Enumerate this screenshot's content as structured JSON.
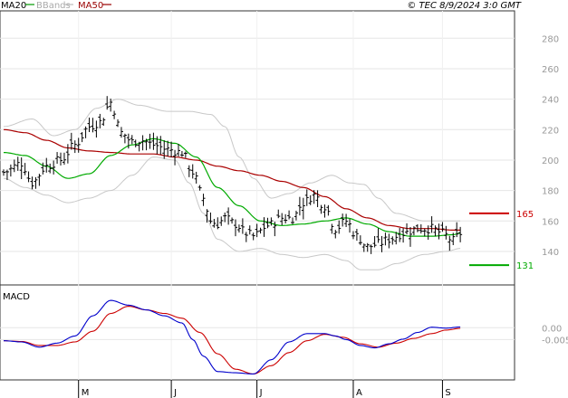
{
  "header": {
    "copyright": "© TEC 8/9/2024 3:0 GMT"
  },
  "chart_data": [
    {
      "type": "line",
      "panel": "price",
      "legend": [
        {
          "name": "MA20",
          "color": "#00aa00"
        },
        {
          "name": "BBands",
          "color": "#bbbbbb"
        },
        {
          "name": "MA50",
          "color": "#aa0000"
        }
      ],
      "legend_placement": "top-left",
      "ylim": [
        118,
        298
      ],
      "yticks": [
        140,
        160,
        180,
        200,
        220,
        240,
        260,
        280
      ],
      "grid": true,
      "x_range": [
        0,
        130
      ],
      "month_ticks": [
        {
          "label": "M",
          "x": 21
        },
        {
          "label": "J",
          "x": 47
        },
        {
          "label": "J",
          "x": 71
        },
        {
          "label": "A",
          "x": 98
        },
        {
          "label": "S",
          "x": 123
        }
      ],
      "levels": [
        {
          "name": "resistance",
          "value": 165,
          "label": "165",
          "color": "#cc0000"
        },
        {
          "name": "support",
          "value": 131,
          "label": "131",
          "color": "#00aa00"
        }
      ],
      "close_anchors": [
        [
          0,
          192
        ],
        [
          5,
          198
        ],
        [
          8,
          185
        ],
        [
          12,
          196
        ],
        [
          16,
          200
        ],
        [
          20,
          210
        ],
        [
          24,
          222
        ],
        [
          27,
          225
        ],
        [
          30,
          238
        ],
        [
          33,
          218
        ],
        [
          36,
          212
        ],
        [
          39,
          213
        ],
        [
          42,
          210
        ],
        [
          46,
          207
        ],
        [
          50,
          205
        ],
        [
          53,
          192
        ],
        [
          56,
          175
        ],
        [
          58,
          160
        ],
        [
          60,
          158
        ],
        [
          62,
          162
        ],
        [
          65,
          158
        ],
        [
          68,
          152
        ],
        [
          70,
          150
        ],
        [
          74,
          157
        ],
        [
          78,
          162
        ],
        [
          81,
          162
        ],
        [
          84,
          172
        ],
        [
          87,
          177
        ],
        [
          90,
          170
        ],
        [
          93,
          155
        ],
        [
          96,
          160
        ],
        [
          99,
          150
        ],
        [
          102,
          143
        ],
        [
          105,
          145
        ],
        [
          108,
          148
        ],
        [
          112,
          152
        ],
        [
          116,
          155
        ],
        [
          120,
          155
        ],
        [
          123,
          152
        ],
        [
          126,
          147
        ],
        [
          128,
          152
        ]
      ],
      "ma20_anchors": [
        [
          0,
          205
        ],
        [
          6,
          203
        ],
        [
          12,
          196
        ],
        [
          18,
          188
        ],
        [
          24,
          191
        ],
        [
          30,
          203
        ],
        [
          36,
          210
        ],
        [
          42,
          214
        ],
        [
          48,
          211
        ],
        [
          54,
          202
        ],
        [
          60,
          182
        ],
        [
          66,
          170
        ],
        [
          72,
          160
        ],
        [
          78,
          157
        ],
        [
          84,
          158
        ],
        [
          90,
          160
        ],
        [
          96,
          162
        ],
        [
          102,
          158
        ],
        [
          108,
          153
        ],
        [
          114,
          150
        ],
        [
          120,
          150
        ],
        [
          126,
          151
        ],
        [
          128,
          152
        ]
      ],
      "ma50_anchors": [
        [
          0,
          220
        ],
        [
          6,
          218
        ],
        [
          12,
          213
        ],
        [
          18,
          208
        ],
        [
          24,
          206
        ],
        [
          30,
          205
        ],
        [
          36,
          204
        ],
        [
          42,
          204
        ],
        [
          48,
          202
        ],
        [
          54,
          200
        ],
        [
          60,
          196
        ],
        [
          66,
          193
        ],
        [
          72,
          190
        ],
        [
          78,
          186
        ],
        [
          84,
          182
        ],
        [
          90,
          176
        ],
        [
          96,
          168
        ],
        [
          102,
          162
        ],
        [
          108,
          157
        ],
        [
          114,
          155
        ],
        [
          120,
          155
        ],
        [
          126,
          154
        ],
        [
          128,
          154
        ]
      ],
      "bb_upper_anchors": [
        [
          0,
          222
        ],
        [
          8,
          227
        ],
        [
          14,
          216
        ],
        [
          20,
          220
        ],
        [
          26,
          234
        ],
        [
          32,
          240
        ],
        [
          38,
          236
        ],
        [
          46,
          232
        ],
        [
          52,
          232
        ],
        [
          58,
          230
        ],
        [
          62,
          222
        ],
        [
          66,
          202
        ],
        [
          70,
          188
        ],
        [
          75,
          175
        ],
        [
          80,
          178
        ],
        [
          86,
          185
        ],
        [
          92,
          190
        ],
        [
          97,
          185
        ],
        [
          101,
          184
        ],
        [
          105,
          175
        ],
        [
          110,
          165
        ],
        [
          118,
          160
        ],
        [
          128,
          160
        ]
      ],
      "bb_lower_anchors": [
        [
          0,
          188
        ],
        [
          6,
          182
        ],
        [
          12,
          177
        ],
        [
          18,
          172
        ],
        [
          24,
          175
        ],
        [
          30,
          180
        ],
        [
          36,
          190
        ],
        [
          42,
          202
        ],
        [
          48,
          200
        ],
        [
          52,
          185
        ],
        [
          56,
          165
        ],
        [
          60,
          148
        ],
        [
          66,
          140
        ],
        [
          72,
          142
        ],
        [
          78,
          138
        ],
        [
          84,
          136
        ],
        [
          90,
          138
        ],
        [
          96,
          134
        ],
        [
          100,
          128
        ],
        [
          105,
          128
        ],
        [
          110,
          132
        ],
        [
          118,
          138
        ],
        [
          124,
          140
        ],
        [
          128,
          142
        ]
      ]
    },
    {
      "type": "line",
      "panel": "macd",
      "title": "MACD",
      "ylim": [
        -0.022,
        0.018
      ],
      "yticks": [
        {
          "value": 0.0,
          "label": "0.00"
        },
        {
          "value": -0.005,
          "label": "-0.005"
        }
      ],
      "macd_color": "#0000cc",
      "signal_color": "#cc0000",
      "macd_anchors": [
        [
          0,
          -0.0055
        ],
        [
          5,
          -0.006
        ],
        [
          10,
          -0.0082
        ],
        [
          15,
          -0.0065
        ],
        [
          20,
          -0.0035
        ],
        [
          25,
          0.005
        ],
        [
          30,
          0.0115
        ],
        [
          35,
          0.0095
        ],
        [
          40,
          0.0075
        ],
        [
          45,
          0.005
        ],
        [
          50,
          0.002
        ],
        [
          53,
          -0.005
        ],
        [
          56,
          -0.012
        ],
        [
          60,
          -0.0185
        ],
        [
          65,
          -0.019
        ],
        [
          70,
          -0.0195
        ],
        [
          75,
          -0.0135
        ],
        [
          80,
          -0.006
        ],
        [
          85,
          -0.0025
        ],
        [
          90,
          -0.0025
        ],
        [
          93,
          -0.0035
        ],
        [
          96,
          -0.005
        ],
        [
          100,
          -0.0075
        ],
        [
          104,
          -0.0085
        ],
        [
          108,
          -0.0068
        ],
        [
          112,
          -0.0048
        ],
        [
          116,
          -0.002
        ],
        [
          120,
          0.0002
        ],
        [
          124,
          -0.0002
        ],
        [
          128,
          0.0003
        ]
      ],
      "signal_anchors": [
        [
          0,
          -0.0055
        ],
        [
          5,
          -0.0058
        ],
        [
          10,
          -0.0075
        ],
        [
          15,
          -0.0075
        ],
        [
          20,
          -0.006
        ],
        [
          25,
          -0.0015
        ],
        [
          30,
          0.006
        ],
        [
          35,
          0.009
        ],
        [
          40,
          0.0075
        ],
        [
          45,
          0.006
        ],
        [
          50,
          0.004
        ],
        [
          55,
          -0.002
        ],
        [
          60,
          -0.011
        ],
        [
          65,
          -0.0175
        ],
        [
          70,
          -0.0195
        ],
        [
          75,
          -0.016
        ],
        [
          80,
          -0.0105
        ],
        [
          85,
          -0.0055
        ],
        [
          90,
          -0.0028
        ],
        [
          95,
          -0.004
        ],
        [
          100,
          -0.0068
        ],
        [
          105,
          -0.0082
        ],
        [
          110,
          -0.0065
        ],
        [
          115,
          -0.0045
        ],
        [
          120,
          -0.0025
        ],
        [
          124,
          -0.001
        ],
        [
          128,
          -0.0003
        ]
      ]
    }
  ]
}
